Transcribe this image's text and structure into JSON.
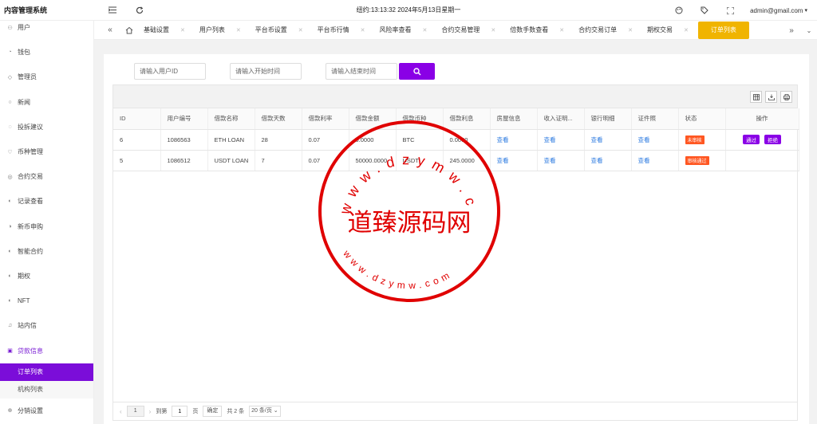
{
  "header": {
    "brand": "内容管理系统",
    "clock": "纽约:13:13:32 2024年5月13日星期一",
    "user": "admin@gmail.com"
  },
  "sidebar": {
    "items": [
      {
        "label": "用户",
        "icon": "user-icon"
      },
      {
        "label": "钱包",
        "icon": "wallet-icon"
      },
      {
        "label": "管理员",
        "icon": "shield-icon"
      },
      {
        "label": "新闻",
        "icon": "news-icon"
      },
      {
        "label": "投拆建议",
        "icon": "suggestion-icon"
      },
      {
        "label": "币种管理",
        "icon": "coin-icon"
      },
      {
        "label": "合约交易",
        "icon": "contract-icon"
      },
      {
        "label": "记录查看",
        "icon": "record-icon"
      },
      {
        "label": "新币申购",
        "icon": "subscribe-icon"
      },
      {
        "label": "智能合约",
        "icon": "smart-contract-icon"
      },
      {
        "label": "期权",
        "icon": "option-icon"
      },
      {
        "label": "NFT",
        "icon": "nft-icon"
      },
      {
        "label": "站内信",
        "icon": "message-icon"
      },
      {
        "label": "贷款信息",
        "icon": "loan-icon"
      }
    ],
    "submenu": [
      {
        "label": "订单列表"
      },
      {
        "label": "机构列表"
      }
    ],
    "last_item": {
      "label": "分销设置",
      "icon": "distribution-icon"
    }
  },
  "tabs": [
    {
      "label": "基础设置"
    },
    {
      "label": "用户列表"
    },
    {
      "label": "平台币设置"
    },
    {
      "label": "平台币行情"
    },
    {
      "label": "风险率查看"
    },
    {
      "label": "合约交易管理"
    },
    {
      "label": "倍数手数查看"
    },
    {
      "label": "合约交易订单"
    },
    {
      "label": "期权交易"
    },
    {
      "label": "订单列表"
    }
  ],
  "search": {
    "user_id_placeholder": "请输入用户ID",
    "start_time_placeholder": "请输入开始时间",
    "end_time_placeholder": "请输入结束时间"
  },
  "table": {
    "columns": [
      "ID",
      "用户编号",
      "借款名称",
      "借款天数",
      "借款利率",
      "借款金额",
      "借款币种",
      "借款利息",
      "房屋信息",
      "收入证明...",
      "银行明细",
      "证件照",
      "状态",
      "操作"
    ],
    "rows": [
      {
        "id": "6",
        "user_no": "1086563",
        "name": "ETH LOAN",
        "days": "28",
        "rate": "0.07",
        "amount": "0.0000",
        "currency": "BTC",
        "interest": "0.0000",
        "house": "查看",
        "income": "查看",
        "bank": "查看",
        "idphoto": "查看",
        "status": "未审核",
        "approve": "通过",
        "reject": "拒绝"
      },
      {
        "id": "5",
        "user_no": "1086512",
        "name": "USDT LOAN",
        "days": "7",
        "rate": "0.07",
        "amount": "50000.0000",
        "currency": "USDT",
        "interest": "245.0000",
        "house": "查看",
        "income": "查看",
        "bank": "查看",
        "idphoto": "查看",
        "status": "审核通过"
      }
    ]
  },
  "pager": {
    "current_page": "1",
    "goto_label": "到第",
    "goto_value": "1",
    "page_unit": "页",
    "confirm": "确定",
    "total": "共 2 条",
    "page_size": "20 条/页"
  },
  "watermark": {
    "title": "道臻源码网",
    "url_top": "www.dzymw.com",
    "url_bottom": "www.dzymw.com"
  },
  "colors": {
    "accent": "#8a00e6",
    "active_tab": "#f0b400",
    "status_badge": "#ff5722",
    "stamp": "#e00000"
  }
}
